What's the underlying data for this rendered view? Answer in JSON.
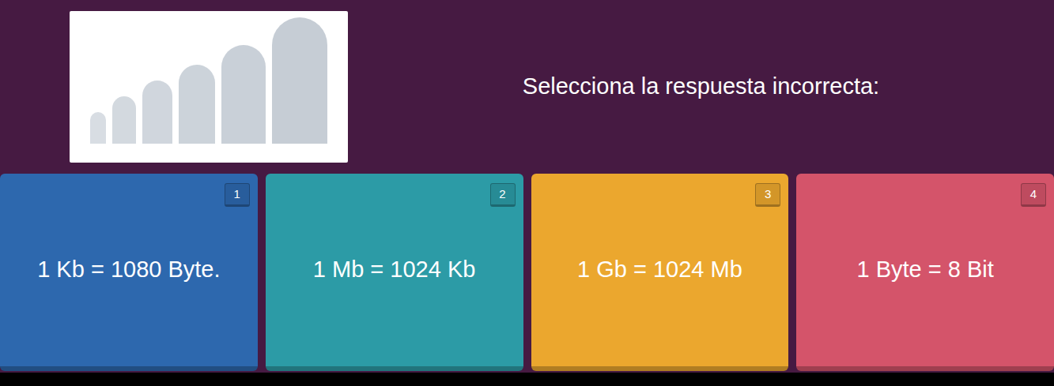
{
  "question": {
    "text": "Selecciona la respuesta incorrecta:"
  },
  "answers": [
    {
      "number": "1",
      "text": "1 Kb = 1080 Byte.",
      "color": "#2d68ae"
    },
    {
      "number": "2",
      "text": "1 Mb = 1024 Kb",
      "color": "#2c9ba6"
    },
    {
      "number": "3",
      "text": "1 Gb = 1024 Mb",
      "color": "#eba72e"
    },
    {
      "number": "4",
      "text": "1 Byte = 8 Bit",
      "color": "#d4546a"
    }
  ]
}
